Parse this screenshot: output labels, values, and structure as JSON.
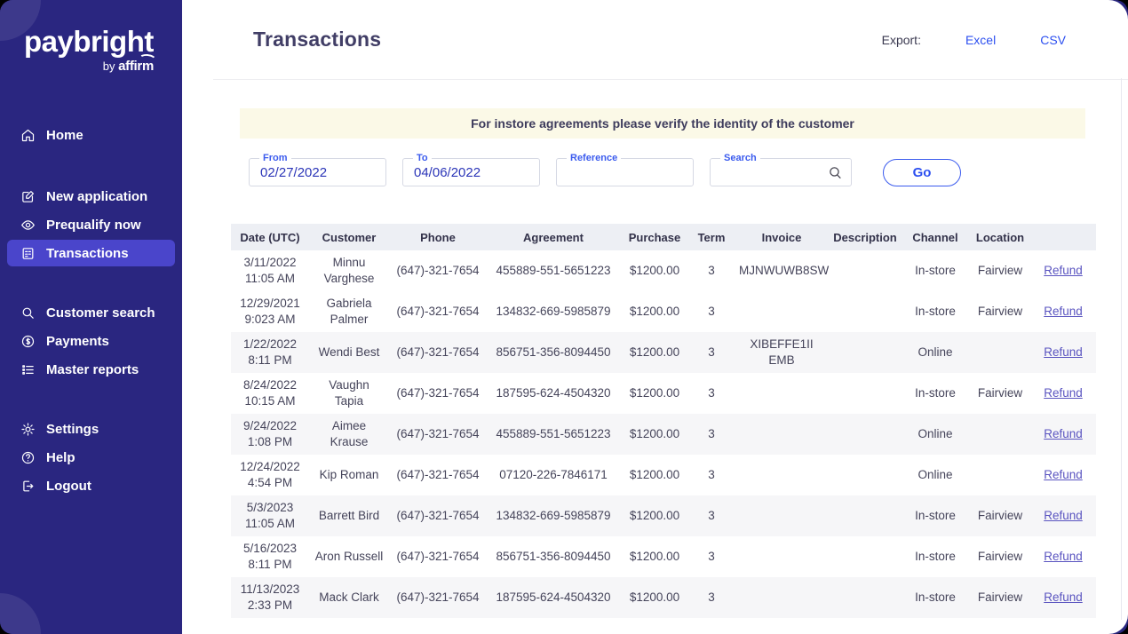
{
  "sidebar": {
    "logo": "paybright",
    "logo_by": "by",
    "logo_brand": "affirm",
    "items": [
      {
        "label": "Home",
        "icon": "home-icon"
      },
      {
        "label": "New application",
        "icon": "edit-icon"
      },
      {
        "label": "Prequalify now",
        "icon": "eye-icon"
      },
      {
        "label": "Transactions",
        "icon": "document-icon",
        "active": true
      },
      {
        "label": "Customer search",
        "icon": "search-icon"
      },
      {
        "label": "Payments",
        "icon": "dollar-circle-icon"
      },
      {
        "label": "Master reports",
        "icon": "list-icon"
      },
      {
        "label": "Settings",
        "icon": "gear-icon"
      },
      {
        "label": "Help",
        "icon": "question-circle-icon"
      },
      {
        "label": "Logout",
        "icon": "logout-icon"
      }
    ]
  },
  "header": {
    "title": "Transactions",
    "export_label": "Export:",
    "export_links": [
      "Excel",
      "CSV"
    ]
  },
  "banner": {
    "text": "For instore agreements please verify the identity of the customer"
  },
  "filters": {
    "from": {
      "label": "From",
      "value": "02/27/2022"
    },
    "to": {
      "label": "To",
      "value": "04/06/2022"
    },
    "reference": {
      "label": "Reference",
      "value": ""
    },
    "search": {
      "label": "Search",
      "value": "",
      "icon": "search-icon"
    },
    "go": "Go"
  },
  "table": {
    "columns": [
      "Date (UTC)",
      "Customer",
      "Phone",
      "Agreement",
      "Purchase",
      "Term",
      "Invoice",
      "Description",
      "Channel",
      "Location",
      ""
    ],
    "rows": [
      {
        "date": "3/11/2022",
        "time": "11:05 AM",
        "customer": "Minnu Varghese",
        "phone": "(647)-321-7654",
        "agreement": "455889-551-5651223",
        "purchase": "$1200.00",
        "term": "3",
        "invoice": "MJNWUWB8SW",
        "description": "",
        "channel": "In-store",
        "location": "Fairview",
        "action": "Refund"
      },
      {
        "date": "12/29/2021",
        "time": "9:023 AM",
        "customer": "Gabriela Palmer",
        "phone": "(647)-321-7654",
        "agreement": "134832-669-5985879",
        "purchase": "$1200.00",
        "term": "3",
        "invoice": "",
        "description": "",
        "channel": "In-store",
        "location": "Fairview",
        "action": "Refund"
      },
      {
        "date": "1/22/2022",
        "time": "8:11 PM",
        "customer": "Wendi Best",
        "phone": "(647)-321-7654",
        "agreement": "856751-356-8094450",
        "purchase": "$1200.00",
        "term": "3",
        "invoice": "XIBEFFE1II EMB",
        "description": "",
        "channel": "Online",
        "location": "",
        "action": "Refund"
      },
      {
        "date": "8/24/2022",
        "time": "10:15 AM",
        "customer": "Vaughn Tapia",
        "phone": "(647)-321-7654",
        "agreement": "187595-624-4504320",
        "purchase": "$1200.00",
        "term": "3",
        "invoice": "",
        "description": "",
        "channel": "In-store",
        "location": "Fairview",
        "action": "Refund"
      },
      {
        "date": "9/24/2022",
        "time": "1:08 PM",
        "customer": "Aimee Krause",
        "phone": "(647)-321-7654",
        "agreement": "455889-551-5651223",
        "purchase": "$1200.00",
        "term": "3",
        "invoice": "",
        "description": "",
        "channel": "Online",
        "location": "",
        "action": "Refund"
      },
      {
        "date": "12/24/2022",
        "time": "4:54 PM",
        "customer": "Kip Roman",
        "phone": "(647)-321-7654",
        "agreement": "07120-226-7846171",
        "purchase": "$1200.00",
        "term": "3",
        "invoice": "",
        "description": "",
        "channel": "Online",
        "location": "",
        "action": "Refund"
      },
      {
        "date": "5/3/2023",
        "time": "11:05 AM",
        "customer": "Barrett Bird",
        "phone": "(647)-321-7654",
        "agreement": "134832-669-5985879",
        "purchase": "$1200.00",
        "term": "3",
        "invoice": "",
        "description": "",
        "channel": "In-store",
        "location": "Fairview",
        "action": "Refund"
      },
      {
        "date": "5/16/2023",
        "time": "8:11 PM",
        "customer": "Aron Russell",
        "phone": "(647)-321-7654",
        "agreement": "856751-356-8094450",
        "purchase": "$1200.00",
        "term": "3",
        "invoice": "",
        "description": "",
        "channel": "In-store",
        "location": "Fairview",
        "action": "Refund"
      },
      {
        "date": "11/13/2023",
        "time": "2:33 PM",
        "customer": "Mack Clark",
        "phone": "(647)-321-7654",
        "agreement": "187595-624-4504320",
        "purchase": "$1200.00",
        "term": "3",
        "invoice": "",
        "description": "",
        "channel": "In-store",
        "location": "Fairview",
        "action": "Refund"
      }
    ]
  },
  "colors": {
    "sidebar_bg": "#2a2680",
    "active_item_bg": "#4a45cb",
    "link_blue": "#2d50f0",
    "field_label_blue": "#3b5bee",
    "field_value_blue": "#2b35b8",
    "banner_bg": "#fbf9e7",
    "table_header_bg": "#edeff4",
    "row_stripe_bg": "#f6f6f8",
    "refund_link": "#5a54c0",
    "title_text": "#413e66"
  }
}
